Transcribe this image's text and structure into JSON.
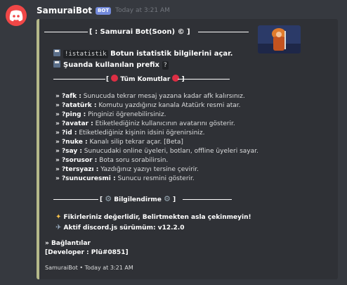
{
  "message": {
    "author": "SamuraiBot",
    "tag": "BOT",
    "timestamp": "Today at 3:21 AM"
  },
  "embed": {
    "accent_color": "#b5b98a",
    "title": "[ : Samurai Bot(Soon) © ]",
    "stats": {
      "command": "!istatistik",
      "text": "Botun istatistik bilgilerini açar.",
      "prefix_text": "Şuanda kullanılan prefix",
      "prefix_value": "?"
    },
    "commands_header": "Tüm Komutlar",
    "commands": [
      {
        "name": "» ?afk :",
        "desc": "Sunucuda tekrar mesaj yazana kadar afk kalırsınız."
      },
      {
        "name": "» ?atatürk :",
        "desc": "Komutu yazdığınız kanala Atatürk resmi atar."
      },
      {
        "name": "» ?ping :",
        "desc": "Pinginizi öğrenebilirsiniz."
      },
      {
        "name": "» ?avatar :",
        "desc": "Etiketlediğiniz kullanıcının avatarını gösterir."
      },
      {
        "name": "» ?id :",
        "desc": "Etiketlediğiniz kişinin idsini öğrenirsiniz."
      },
      {
        "name": "» ?nuke :",
        "desc": "Kanalı silip tekrar açar. [Beta]"
      },
      {
        "name": "» ?say :",
        "desc": "Sunucudaki online üyeleri, botları, offline üyeleri sayar."
      },
      {
        "name": "» ?sorusor :",
        "desc": "Bota soru sorabilirsin."
      },
      {
        "name": "» ?tersyazı :",
        "desc": "Yazdığınız yazıyı tersine çevirir."
      },
      {
        "name": "» ?sunucuresmi :",
        "desc": "Sunucu resmini gösterir."
      }
    ],
    "info_header": "Bilgilendirme",
    "info_lines": [
      "Fikirleriniz değerlidir, Belirtmekten asla çekinmeyin!",
      "Aktif discord.js sürümüm: v12.2.0"
    ],
    "links_header": "» Bağlantılar",
    "developer": "[Developer : Plü#0851]",
    "footer": "SamuraiBot • Today at 3:21 AM"
  }
}
